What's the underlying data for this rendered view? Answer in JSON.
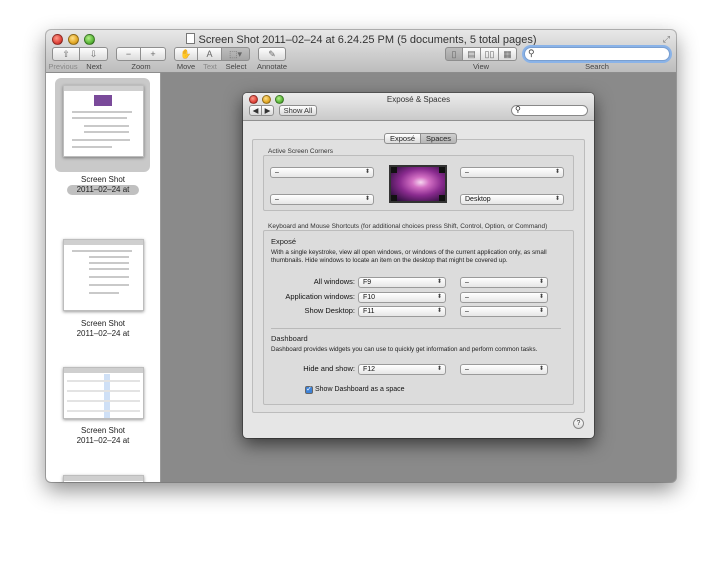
{
  "window": {
    "title": "Screen Shot 2011–02–24 at 6.24.25 PM (5 documents, 5 total pages)"
  },
  "toolbar": {
    "previous": "Previous",
    "next": "Next",
    "zoom": "Zoom",
    "move": "Move",
    "text": "Text",
    "select": "Select",
    "annotate": "Annotate",
    "view": "View",
    "search": "Search",
    "search_value": ""
  },
  "sidebar": {
    "items": [
      {
        "line1": "Screen Shot",
        "line2": "2011–02–24 at",
        "selected": true
      },
      {
        "line1": "Screen Shot",
        "line2": "2011–02–24 at",
        "selected": false
      },
      {
        "line1": "Screen Shot",
        "line2": "2011–02–24 at",
        "selected": false
      }
    ]
  },
  "prefs": {
    "title": "Exposé & Spaces",
    "show_all": "Show All",
    "tabs": [
      "Exposé",
      "Spaces"
    ],
    "corners_label": "Active Screen Corners",
    "corner_tl": "–",
    "corner_tr": "–",
    "corner_bl": "–",
    "corner_br": "Desktop",
    "shortcuts_label": "Keyboard and Mouse Shortcuts (for additional choices press Shift, Control, Option, or Command)",
    "expose_head": "Exposé",
    "expose_desc": "With a single keystroke, view all open windows, or windows of the current application only, as small thumbnails. Hide windows to locate an item on the desktop that might be covered up.",
    "rows": [
      {
        "label": "All windows:",
        "key": "F9",
        "mouse": "–"
      },
      {
        "label": "Application windows:",
        "key": "F10",
        "mouse": "–"
      },
      {
        "label": "Show Desktop:",
        "key": "F11",
        "mouse": "–"
      }
    ],
    "dashboard_head": "Dashboard",
    "dashboard_desc": "Dashboard provides widgets you can use to quickly get information and perform common tasks.",
    "dash_row": {
      "label": "Hide and show:",
      "key": "F12",
      "mouse": "–"
    },
    "show_dashboard_space": "Show Dashboard as a space",
    "help": "?"
  }
}
